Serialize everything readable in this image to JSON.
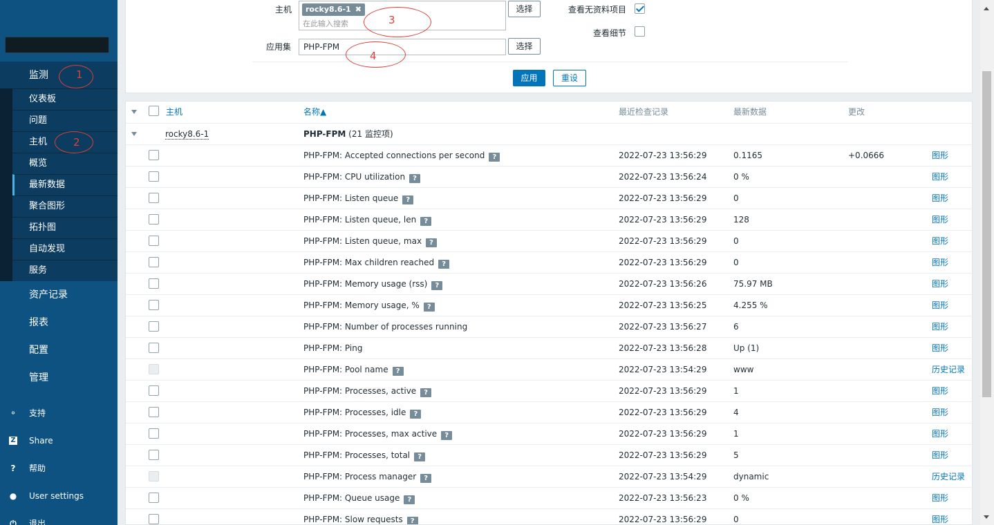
{
  "sidebar": {
    "main_menu": [
      {
        "label": "监测"
      },
      {
        "label": "资产记录"
      },
      {
        "label": "报表"
      },
      {
        "label": "配置"
      },
      {
        "label": "管理"
      }
    ],
    "submenu": [
      {
        "label": "仪表板"
      },
      {
        "label": "问题"
      },
      {
        "label": "主机"
      },
      {
        "label": "概览"
      },
      {
        "label": "最新数据",
        "active": true
      },
      {
        "label": "聚合图形"
      },
      {
        "label": "拓扑图"
      },
      {
        "label": "自动发现"
      },
      {
        "label": "服务"
      }
    ],
    "bottom": [
      {
        "label": "支持",
        "icon": "headset-icon"
      },
      {
        "label": "Share",
        "icon": "share-icon"
      },
      {
        "label": "帮助",
        "icon": "help-icon"
      },
      {
        "label": "User settings",
        "icon": "user-icon"
      },
      {
        "label": "退出",
        "icon": "power-icon"
      }
    ]
  },
  "filter": {
    "host_label": "主机",
    "host_tag": "rocky8.6-1",
    "host_placeholder": "在此输入搜索",
    "app_label": "应用集",
    "app_value": "PHP-FPM",
    "select_label": "选择",
    "show_without_data_label": "查看无资料项目",
    "show_without_data": true,
    "show_details_label": "查看细节",
    "show_details": false,
    "apply_label": "应用",
    "reset_label": "重设"
  },
  "annotations": [
    "1",
    "2",
    "3",
    "4"
  ],
  "table": {
    "headers": {
      "host": "主机",
      "name": "名称▲",
      "last_check": "最近检查记录",
      "last_value": "最新数据",
      "change": "更改"
    },
    "group": {
      "host": "rocky8.6-1",
      "app": "PHP-FPM",
      "count": "(21 监控项)"
    },
    "rows": [
      {
        "name": "PHP-FPM: Accepted connections per second",
        "time": "2022-07-23 13:56:29",
        "value": "0.1165",
        "change": "+0.0666",
        "link": "图形",
        "help": true,
        "disabled": false
      },
      {
        "name": "PHP-FPM: CPU utilization",
        "time": "2022-07-23 13:56:24",
        "value": "0 %",
        "change": "",
        "link": "图形",
        "help": true,
        "disabled": false
      },
      {
        "name": "PHP-FPM: Listen queue",
        "time": "2022-07-23 13:56:29",
        "value": "0",
        "change": "",
        "link": "图形",
        "help": true,
        "disabled": false
      },
      {
        "name": "PHP-FPM: Listen queue, len",
        "time": "2022-07-23 13:56:29",
        "value": "128",
        "change": "",
        "link": "图形",
        "help": true,
        "disabled": false
      },
      {
        "name": "PHP-FPM: Listen queue, max",
        "time": "2022-07-23 13:56:29",
        "value": "0",
        "change": "",
        "link": "图形",
        "help": true,
        "disabled": false
      },
      {
        "name": "PHP-FPM: Max children reached",
        "time": "2022-07-23 13:56:29",
        "value": "0",
        "change": "",
        "link": "图形",
        "help": true,
        "disabled": false
      },
      {
        "name": "PHP-FPM: Memory usage (rss)",
        "time": "2022-07-23 13:56:26",
        "value": "75.97 MB",
        "change": "",
        "link": "图形",
        "help": true,
        "disabled": false
      },
      {
        "name": "PHP-FPM: Memory usage, %",
        "time": "2022-07-23 13:56:25",
        "value": "4.255 %",
        "change": "",
        "link": "图形",
        "help": true,
        "disabled": false
      },
      {
        "name": "PHP-FPM: Number of processes running",
        "time": "2022-07-23 13:56:27",
        "value": "6",
        "change": "",
        "link": "图形",
        "help": false,
        "disabled": false
      },
      {
        "name": "PHP-FPM: Ping",
        "time": "2022-07-23 13:56:28",
        "value": "Up (1)",
        "change": "",
        "link": "图形",
        "help": false,
        "disabled": false
      },
      {
        "name": "PHP-FPM: Pool name",
        "time": "2022-07-23 13:54:29",
        "value": "www",
        "change": "",
        "link": "历史记录",
        "help": true,
        "disabled": true
      },
      {
        "name": "PHP-FPM: Processes, active",
        "time": "2022-07-23 13:56:29",
        "value": "1",
        "change": "",
        "link": "图形",
        "help": true,
        "disabled": false
      },
      {
        "name": "PHP-FPM: Processes, idle",
        "time": "2022-07-23 13:56:29",
        "value": "4",
        "change": "",
        "link": "图形",
        "help": true,
        "disabled": false
      },
      {
        "name": "PHP-FPM: Processes, max active",
        "time": "2022-07-23 13:56:29",
        "value": "1",
        "change": "",
        "link": "图形",
        "help": true,
        "disabled": false
      },
      {
        "name": "PHP-FPM: Processes, total",
        "time": "2022-07-23 13:56:29",
        "value": "5",
        "change": "",
        "link": "图形",
        "help": true,
        "disabled": false
      },
      {
        "name": "PHP-FPM: Process manager",
        "time": "2022-07-23 13:54:29",
        "value": "dynamic",
        "change": "",
        "link": "历史记录",
        "help": true,
        "disabled": true
      },
      {
        "name": "PHP-FPM: Queue usage",
        "time": "2022-07-23 13:56:23",
        "value": "0 %",
        "change": "",
        "link": "图形",
        "help": true,
        "disabled": false
      },
      {
        "name": "PHP-FPM: Slow requests",
        "time": "2022-07-23 13:56:29",
        "value": "0",
        "change": "",
        "link": "图形",
        "help": true,
        "disabled": false
      }
    ]
  }
}
